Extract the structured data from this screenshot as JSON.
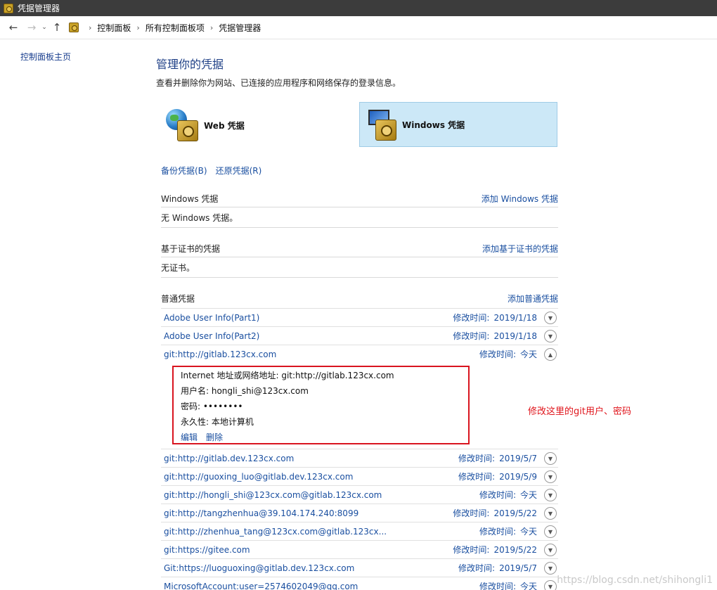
{
  "window": {
    "title": "凭据管理器"
  },
  "address": {
    "crumbs": [
      "控制面板",
      "所有控制面板项",
      "凭据管理器"
    ]
  },
  "sidebar": {
    "home": "控制面板主页"
  },
  "header": {
    "title": "管理你的凭据",
    "description": "查看并删除你为网站、已连接的应用程序和网络保存的登录信息。"
  },
  "cards": {
    "web": "Web 凭据",
    "windows": "Windows 凭据"
  },
  "links": {
    "backup": "备份凭据(B)",
    "restore": "还原凭据(R)"
  },
  "sections": {
    "windows": {
      "title": "Windows 凭据",
      "add": "添加 Windows 凭据",
      "empty": "无 Windows 凭据。"
    },
    "cert": {
      "title": "基于证书的凭据",
      "add": "添加基于证书的凭据",
      "empty": "无证书。"
    },
    "generic": {
      "title": "普通凭据",
      "add": "添加普通凭据"
    }
  },
  "modified_label": "修改时间:",
  "credentials": [
    {
      "name": "Adobe User Info(Part1)",
      "date": "2019/1/18"
    },
    {
      "name": "Adobe User Info(Part2)",
      "date": "2019/1/18"
    },
    {
      "name": "git:http://gitlab.123cx.com",
      "date": "今天",
      "expanded": true
    },
    {
      "name": "git:http://gitlab.dev.123cx.com",
      "date": "2019/5/7"
    },
    {
      "name": "git:http://guoxing_luo@gitlab.dev.123cx.com",
      "date": "2019/5/9"
    },
    {
      "name": "git:http://hongli_shi@123cx.com@gitlab.123cx.com",
      "date": "今天"
    },
    {
      "name": "git:http://tangzhenhua@39.104.174.240:8099",
      "date": "2019/5/22"
    },
    {
      "name": "git:http://zhenhua_tang@123cx.com@gitlab.123cx...",
      "date": "今天"
    },
    {
      "name": "git:https://gitee.com",
      "date": "2019/5/22"
    },
    {
      "name": "Git:https://luoguoxing@gitlab.dev.123cx.com",
      "date": "2019/5/7"
    },
    {
      "name": "MicrosoftAccount:user=2574602049@qq.com",
      "date": "今天"
    }
  ],
  "detail": {
    "address": "Internet 地址或网络地址:  git:http://gitlab.123cx.com",
    "user": "用户名:  hongli_shi@123cx.com",
    "password": "密码:  ••••••••",
    "persistence": "永久性:  本地计算机",
    "edit": "编辑",
    "delete": "删除"
  },
  "annotation": "修改这里的git用户、密码",
  "watermark": "https://blog.csdn.net/shihongli1"
}
